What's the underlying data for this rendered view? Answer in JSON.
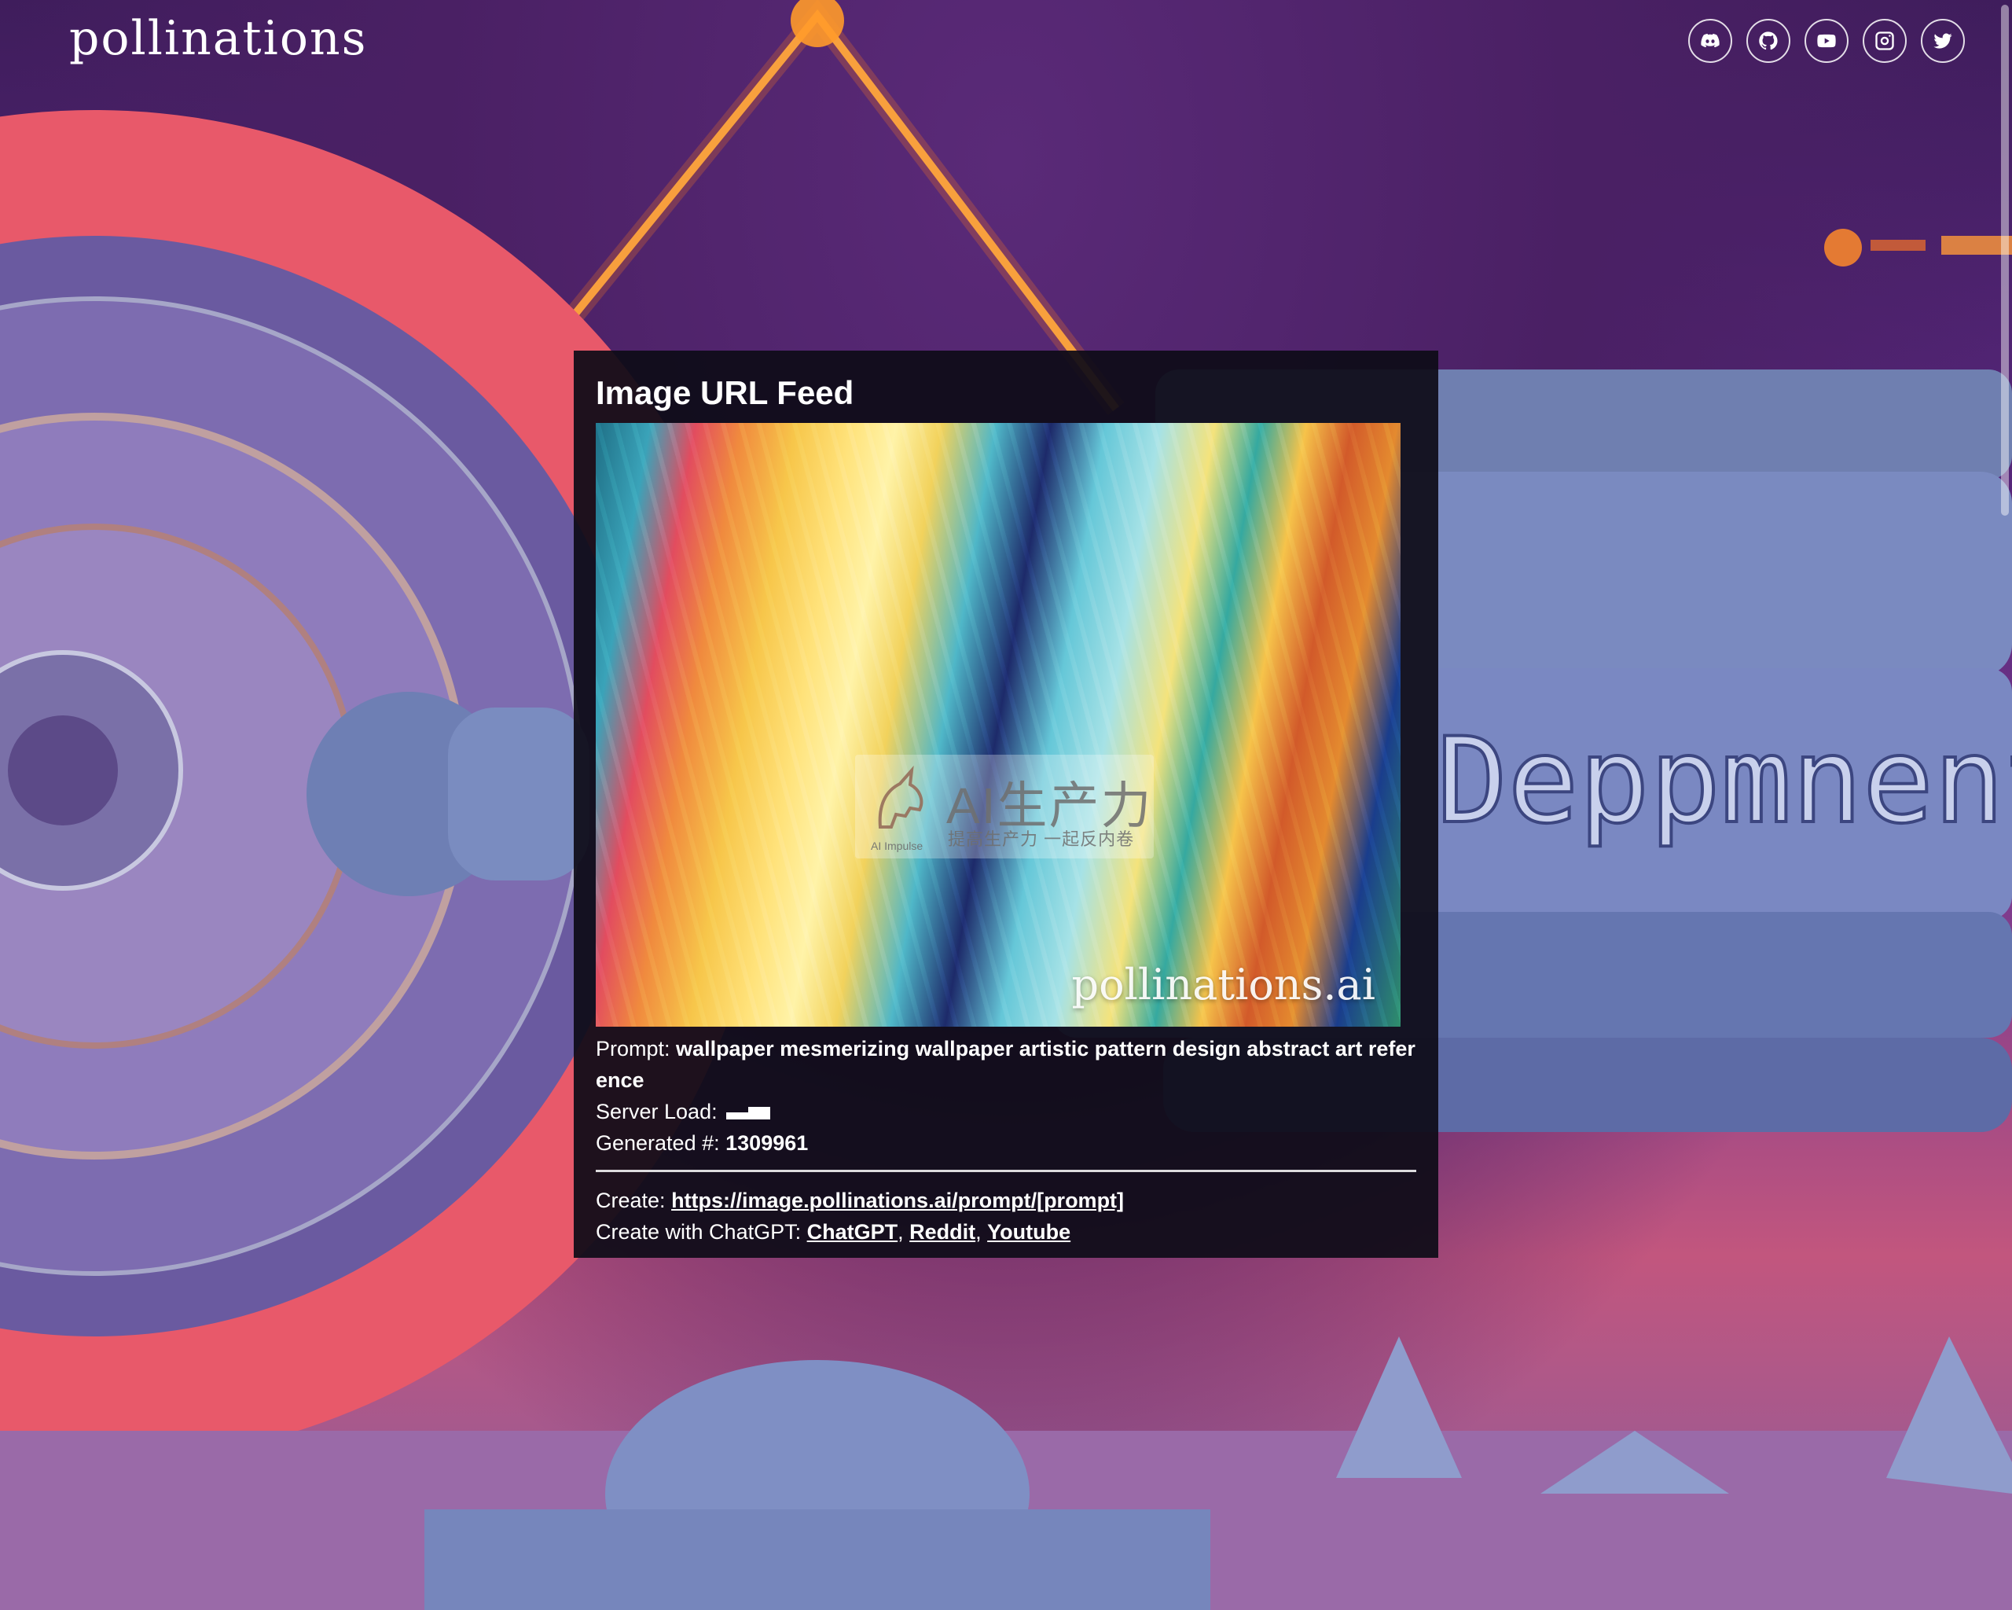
{
  "header": {
    "logo": "pollinations",
    "socials": [
      {
        "name": "discord-icon"
      },
      {
        "name": "github-icon"
      },
      {
        "name": "youtube-icon"
      },
      {
        "name": "instagram-icon"
      },
      {
        "name": "twitter-icon"
      }
    ]
  },
  "background": {
    "sign_text": "Deppmnentas"
  },
  "feed": {
    "title": "Image URL Feed",
    "image": {
      "watermark_title": "AI生产力",
      "watermark_subtitle": "提高生产力 一起反内卷",
      "watermark_small": "AI Impulse",
      "brand": "pollinations.ai"
    },
    "prompt_label": "Prompt:",
    "prompt_value": "wallpaper mesmerizing wallpaper artistic pattern design abstract art reference",
    "server_load_label": "Server Load:",
    "server_load_level": 0.6,
    "generated_label": "Generated #:",
    "generated_value": "1309961",
    "create_label": "Create:",
    "create_link": "https://image.pollinations.ai/prompt/[prompt]",
    "chatgpt_label": "Create with ChatGPT:",
    "chatgpt_links": [
      "ChatGPT",
      "Reddit",
      "Youtube"
    ]
  },
  "colors": {
    "panel_bg": "#0e0c18",
    "text": "#ffffff",
    "scene_purple": "#4a2064",
    "scene_coral": "#e85a6a",
    "scene_steel": "#6f7fb0"
  }
}
